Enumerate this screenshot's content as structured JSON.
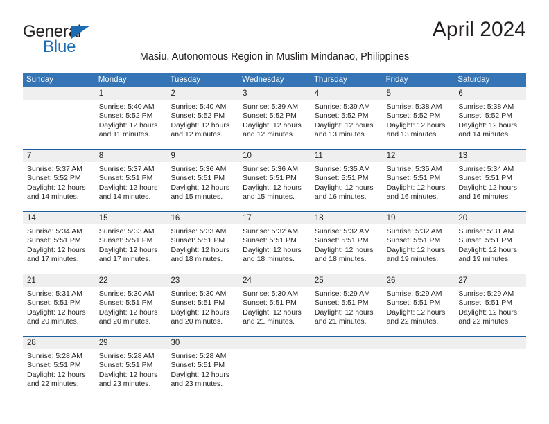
{
  "brand": {
    "name_part1": "General",
    "name_part2": "Blue",
    "triangle_icon": "triangle-logo-icon",
    "color_dark": "#231f20",
    "color_blue": "#1b6cb2"
  },
  "header": {
    "title": "April 2024",
    "subtitle": "Masiu, Autonomous Region in Muslim Mindanao, Philippines"
  },
  "theme": {
    "header_blue": "#3575b5",
    "row_rule_blue": "#1b5f9e",
    "date_band_gray": "#efefef",
    "text": "#231f20"
  },
  "calendar": {
    "weekday_headers": [
      "Sunday",
      "Monday",
      "Tuesday",
      "Wednesday",
      "Thursday",
      "Friday",
      "Saturday"
    ],
    "labels": {
      "sunrise": "Sunrise:",
      "sunset": "Sunset:",
      "daylight": "Daylight:"
    },
    "weeks": [
      {
        "days": [
          {
            "num": "",
            "sunrise": "",
            "sunset": "",
            "daylight_1": "",
            "daylight_2": ""
          },
          {
            "num": "1",
            "sunrise": "Sunrise: 5:40 AM",
            "sunset": "Sunset: 5:52 PM",
            "daylight_1": "Daylight: 12 hours",
            "daylight_2": "and 11 minutes."
          },
          {
            "num": "2",
            "sunrise": "Sunrise: 5:40 AM",
            "sunset": "Sunset: 5:52 PM",
            "daylight_1": "Daylight: 12 hours",
            "daylight_2": "and 12 minutes."
          },
          {
            "num": "3",
            "sunrise": "Sunrise: 5:39 AM",
            "sunset": "Sunset: 5:52 PM",
            "daylight_1": "Daylight: 12 hours",
            "daylight_2": "and 12 minutes."
          },
          {
            "num": "4",
            "sunrise": "Sunrise: 5:39 AM",
            "sunset": "Sunset: 5:52 PM",
            "daylight_1": "Daylight: 12 hours",
            "daylight_2": "and 13 minutes."
          },
          {
            "num": "5",
            "sunrise": "Sunrise: 5:38 AM",
            "sunset": "Sunset: 5:52 PM",
            "daylight_1": "Daylight: 12 hours",
            "daylight_2": "and 13 minutes."
          },
          {
            "num": "6",
            "sunrise": "Sunrise: 5:38 AM",
            "sunset": "Sunset: 5:52 PM",
            "daylight_1": "Daylight: 12 hours",
            "daylight_2": "and 14 minutes."
          }
        ]
      },
      {
        "days": [
          {
            "num": "7",
            "sunrise": "Sunrise: 5:37 AM",
            "sunset": "Sunset: 5:52 PM",
            "daylight_1": "Daylight: 12 hours",
            "daylight_2": "and 14 minutes."
          },
          {
            "num": "8",
            "sunrise": "Sunrise: 5:37 AM",
            "sunset": "Sunset: 5:51 PM",
            "daylight_1": "Daylight: 12 hours",
            "daylight_2": "and 14 minutes."
          },
          {
            "num": "9",
            "sunrise": "Sunrise: 5:36 AM",
            "sunset": "Sunset: 5:51 PM",
            "daylight_1": "Daylight: 12 hours",
            "daylight_2": "and 15 minutes."
          },
          {
            "num": "10",
            "sunrise": "Sunrise: 5:36 AM",
            "sunset": "Sunset: 5:51 PM",
            "daylight_1": "Daylight: 12 hours",
            "daylight_2": "and 15 minutes."
          },
          {
            "num": "11",
            "sunrise": "Sunrise: 5:35 AM",
            "sunset": "Sunset: 5:51 PM",
            "daylight_1": "Daylight: 12 hours",
            "daylight_2": "and 16 minutes."
          },
          {
            "num": "12",
            "sunrise": "Sunrise: 5:35 AM",
            "sunset": "Sunset: 5:51 PM",
            "daylight_1": "Daylight: 12 hours",
            "daylight_2": "and 16 minutes."
          },
          {
            "num": "13",
            "sunrise": "Sunrise: 5:34 AM",
            "sunset": "Sunset: 5:51 PM",
            "daylight_1": "Daylight: 12 hours",
            "daylight_2": "and 16 minutes."
          }
        ]
      },
      {
        "days": [
          {
            "num": "14",
            "sunrise": "Sunrise: 5:34 AM",
            "sunset": "Sunset: 5:51 PM",
            "daylight_1": "Daylight: 12 hours",
            "daylight_2": "and 17 minutes."
          },
          {
            "num": "15",
            "sunrise": "Sunrise: 5:33 AM",
            "sunset": "Sunset: 5:51 PM",
            "daylight_1": "Daylight: 12 hours",
            "daylight_2": "and 17 minutes."
          },
          {
            "num": "16",
            "sunrise": "Sunrise: 5:33 AM",
            "sunset": "Sunset: 5:51 PM",
            "daylight_1": "Daylight: 12 hours",
            "daylight_2": "and 18 minutes."
          },
          {
            "num": "17",
            "sunrise": "Sunrise: 5:32 AM",
            "sunset": "Sunset: 5:51 PM",
            "daylight_1": "Daylight: 12 hours",
            "daylight_2": "and 18 minutes."
          },
          {
            "num": "18",
            "sunrise": "Sunrise: 5:32 AM",
            "sunset": "Sunset: 5:51 PM",
            "daylight_1": "Daylight: 12 hours",
            "daylight_2": "and 18 minutes."
          },
          {
            "num": "19",
            "sunrise": "Sunrise: 5:32 AM",
            "sunset": "Sunset: 5:51 PM",
            "daylight_1": "Daylight: 12 hours",
            "daylight_2": "and 19 minutes."
          },
          {
            "num": "20",
            "sunrise": "Sunrise: 5:31 AM",
            "sunset": "Sunset: 5:51 PM",
            "daylight_1": "Daylight: 12 hours",
            "daylight_2": "and 19 minutes."
          }
        ]
      },
      {
        "days": [
          {
            "num": "21",
            "sunrise": "Sunrise: 5:31 AM",
            "sunset": "Sunset: 5:51 PM",
            "daylight_1": "Daylight: 12 hours",
            "daylight_2": "and 20 minutes."
          },
          {
            "num": "22",
            "sunrise": "Sunrise: 5:30 AM",
            "sunset": "Sunset: 5:51 PM",
            "daylight_1": "Daylight: 12 hours",
            "daylight_2": "and 20 minutes."
          },
          {
            "num": "23",
            "sunrise": "Sunrise: 5:30 AM",
            "sunset": "Sunset: 5:51 PM",
            "daylight_1": "Daylight: 12 hours",
            "daylight_2": "and 20 minutes."
          },
          {
            "num": "24",
            "sunrise": "Sunrise: 5:30 AM",
            "sunset": "Sunset: 5:51 PM",
            "daylight_1": "Daylight: 12 hours",
            "daylight_2": "and 21 minutes."
          },
          {
            "num": "25",
            "sunrise": "Sunrise: 5:29 AM",
            "sunset": "Sunset: 5:51 PM",
            "daylight_1": "Daylight: 12 hours",
            "daylight_2": "and 21 minutes."
          },
          {
            "num": "26",
            "sunrise": "Sunrise: 5:29 AM",
            "sunset": "Sunset: 5:51 PM",
            "daylight_1": "Daylight: 12 hours",
            "daylight_2": "and 22 minutes."
          },
          {
            "num": "27",
            "sunrise": "Sunrise: 5:29 AM",
            "sunset": "Sunset: 5:51 PM",
            "daylight_1": "Daylight: 12 hours",
            "daylight_2": "and 22 minutes."
          }
        ]
      },
      {
        "days": [
          {
            "num": "28",
            "sunrise": "Sunrise: 5:28 AM",
            "sunset": "Sunset: 5:51 PM",
            "daylight_1": "Daylight: 12 hours",
            "daylight_2": "and 22 minutes."
          },
          {
            "num": "29",
            "sunrise": "Sunrise: 5:28 AM",
            "sunset": "Sunset: 5:51 PM",
            "daylight_1": "Daylight: 12 hours",
            "daylight_2": "and 23 minutes."
          },
          {
            "num": "30",
            "sunrise": "Sunrise: 5:28 AM",
            "sunset": "Sunset: 5:51 PM",
            "daylight_1": "Daylight: 12 hours",
            "daylight_2": "and 23 minutes."
          },
          {
            "num": "",
            "sunrise": "",
            "sunset": "",
            "daylight_1": "",
            "daylight_2": ""
          },
          {
            "num": "",
            "sunrise": "",
            "sunset": "",
            "daylight_1": "",
            "daylight_2": ""
          },
          {
            "num": "",
            "sunrise": "",
            "sunset": "",
            "daylight_1": "",
            "daylight_2": ""
          },
          {
            "num": "",
            "sunrise": "",
            "sunset": "",
            "daylight_1": "",
            "daylight_2": ""
          }
        ]
      }
    ]
  }
}
